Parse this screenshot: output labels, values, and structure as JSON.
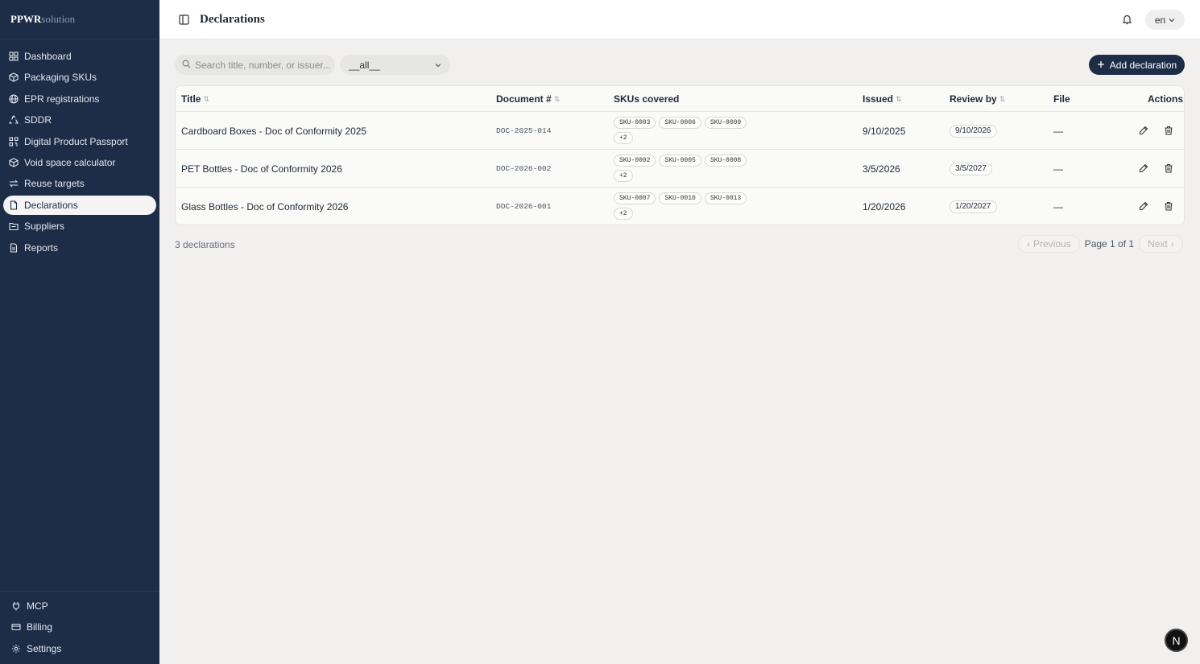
{
  "brand": {
    "part1": "PPWR",
    "part2": "solution"
  },
  "sidebar": {
    "items": [
      {
        "label": "Dashboard",
        "icon": "dashboard-icon"
      },
      {
        "label": "Packaging SKUs",
        "icon": "package-icon"
      },
      {
        "label": "EPR registrations",
        "icon": "globe-icon"
      },
      {
        "label": "SDDR",
        "icon": "recycle-icon"
      },
      {
        "label": "Digital Product Passport",
        "icon": "qr-icon"
      },
      {
        "label": "Void space calculator",
        "icon": "box-icon"
      },
      {
        "label": "Reuse targets",
        "icon": "repeat-icon"
      },
      {
        "label": "Declarations",
        "icon": "file-icon",
        "active": true
      },
      {
        "label": "Suppliers",
        "icon": "folder-icon"
      },
      {
        "label": "Reports",
        "icon": "report-icon"
      }
    ],
    "bottom": [
      {
        "label": "MCP",
        "icon": "plug-icon"
      },
      {
        "label": "Billing",
        "icon": "credit-card-icon"
      },
      {
        "label": "Settings",
        "icon": "gear-icon"
      }
    ]
  },
  "header": {
    "title": "Declarations",
    "lang": "en"
  },
  "toolbar": {
    "search_placeholder": "Search title, number, or issuer...",
    "filter_value": "__all__",
    "add_label": "Add declaration"
  },
  "table": {
    "columns": {
      "title": "Title",
      "doc": "Document #",
      "skus": "SKUs covered",
      "issued": "Issued",
      "review": "Review by",
      "file": "File",
      "actions": "Actions"
    },
    "rows": [
      {
        "title": "Cardboard Boxes - Doc of Conformity 2025",
        "doc": "DOC-2025-014",
        "skus": [
          "SKU-0003",
          "SKU-0006",
          "SKU-0009"
        ],
        "more": "+2",
        "issued": "9/10/2025",
        "review": "9/10/2026",
        "file": "—"
      },
      {
        "title": "PET Bottles - Doc of Conformity 2026",
        "doc": "DOC-2026-002",
        "skus": [
          "SKU-0002",
          "SKU-0005",
          "SKU-0008"
        ],
        "more": "+2",
        "issued": "3/5/2026",
        "review": "3/5/2027",
        "file": "—"
      },
      {
        "title": "Glass Bottles - Doc of Conformity 2026",
        "doc": "DOC-2026-001",
        "skus": [
          "SKU-0007",
          "SKU-0010",
          "SKU-0013"
        ],
        "more": "+2",
        "issued": "1/20/2026",
        "review": "1/20/2027",
        "file": "—"
      }
    ]
  },
  "footer": {
    "count": "3 declarations",
    "prev": "Previous",
    "page": "Page 1 of 1",
    "next": "Next"
  },
  "fab_label": "N"
}
